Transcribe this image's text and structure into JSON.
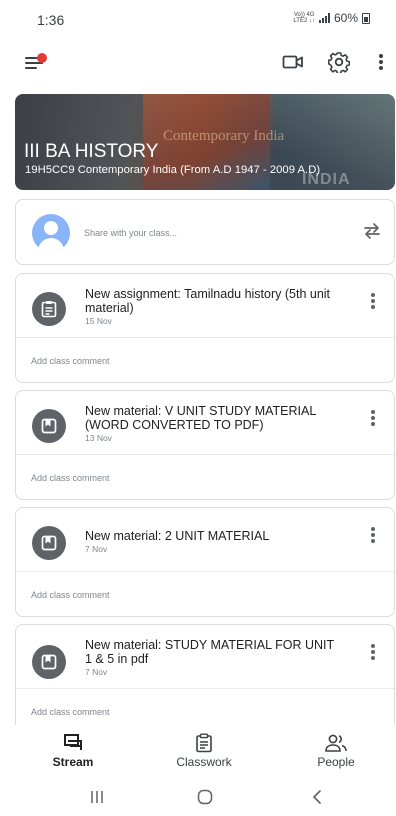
{
  "status_bar": {
    "time": "1:36",
    "network_label": "Vo)) 4G LTE2",
    "battery": "60%"
  },
  "app_bar": {
    "menu_icon": "hamburger-menu-icon",
    "notification_color": "#e53935",
    "icons": [
      "video-camera-icon",
      "gear-icon",
      "more-vert-icon"
    ]
  },
  "banner": {
    "title": "III BA HISTORY",
    "subtitle": "19H5CC9 Contemporary India (From A.D 1947 - 2009 A.D)",
    "image_caption": "Contemporary India",
    "image_watermark": "INDIA"
  },
  "share": {
    "placeholder": "Share with your class...",
    "avatar_color": "#8ab4f8"
  },
  "posts": [
    {
      "title": "New assignment: Tamilnadu history (5th unit material)",
      "date": "15 Nov",
      "icon": "assignment-icon",
      "comment_placeholder": "Add class comment"
    },
    {
      "title": "New material: V UNIT STUDY MATERIAL (WORD CONVERTED TO PDF)",
      "date": "13 Nov",
      "icon": "material-icon",
      "comment_placeholder": "Add class comment"
    },
    {
      "title": "New material: 2 UNIT MATERIAL",
      "date": "7 Nov",
      "icon": "material-icon",
      "comment_placeholder": "Add class comment"
    },
    {
      "title": "New material: STUDY MATERIAL FOR UNIT 1 & 5 in pdf",
      "date": "7 Nov",
      "icon": "material-icon",
      "comment_placeholder": "Add class comment"
    }
  ],
  "bottom_nav": {
    "items": [
      {
        "label": "Stream",
        "icon": "stream-icon",
        "active": true
      },
      {
        "label": "Classwork",
        "icon": "classwork-icon",
        "active": false
      },
      {
        "label": "People",
        "icon": "people-icon",
        "active": false
      }
    ]
  },
  "system_nav": [
    "recent-apps-icon",
    "home-icon",
    "back-icon"
  ]
}
